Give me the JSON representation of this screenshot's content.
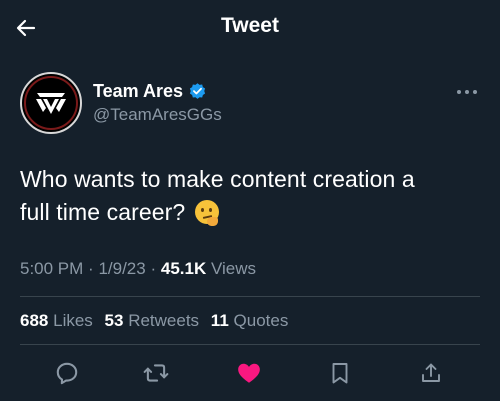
{
  "header": {
    "title": "Tweet",
    "back_icon": "arrow-left-icon"
  },
  "tweet": {
    "author": {
      "display_name": "Team Ares",
      "handle": "@TeamAresGGs",
      "verified": true,
      "avatar_icon": "team-ares-logo"
    },
    "text_line1": "Who wants to make content creation a",
    "text_line2": "full time career?",
    "emoji_icon": "thinking-face-emoji",
    "time": "5:00 PM",
    "date": "1/9/23",
    "views_count": "45.1K",
    "views_label": "Views",
    "separator": "·"
  },
  "stats": {
    "likes_count": "688",
    "likes_label": "Likes",
    "retweets_count": "53",
    "retweets_label": "Retweets",
    "quotes_count": "11",
    "quotes_label": "Quotes"
  },
  "actions": [
    {
      "icon": "reply-icon"
    },
    {
      "icon": "retweet-icon"
    },
    {
      "icon": "like-icon",
      "active": true
    },
    {
      "icon": "bookmark-icon"
    },
    {
      "icon": "share-icon"
    }
  ],
  "colors": {
    "background": "#15202b",
    "secondary_text": "#8b98a5",
    "divider": "#38444d",
    "verified_blue": "#1d9bf0",
    "like_pink": "#f91880"
  }
}
